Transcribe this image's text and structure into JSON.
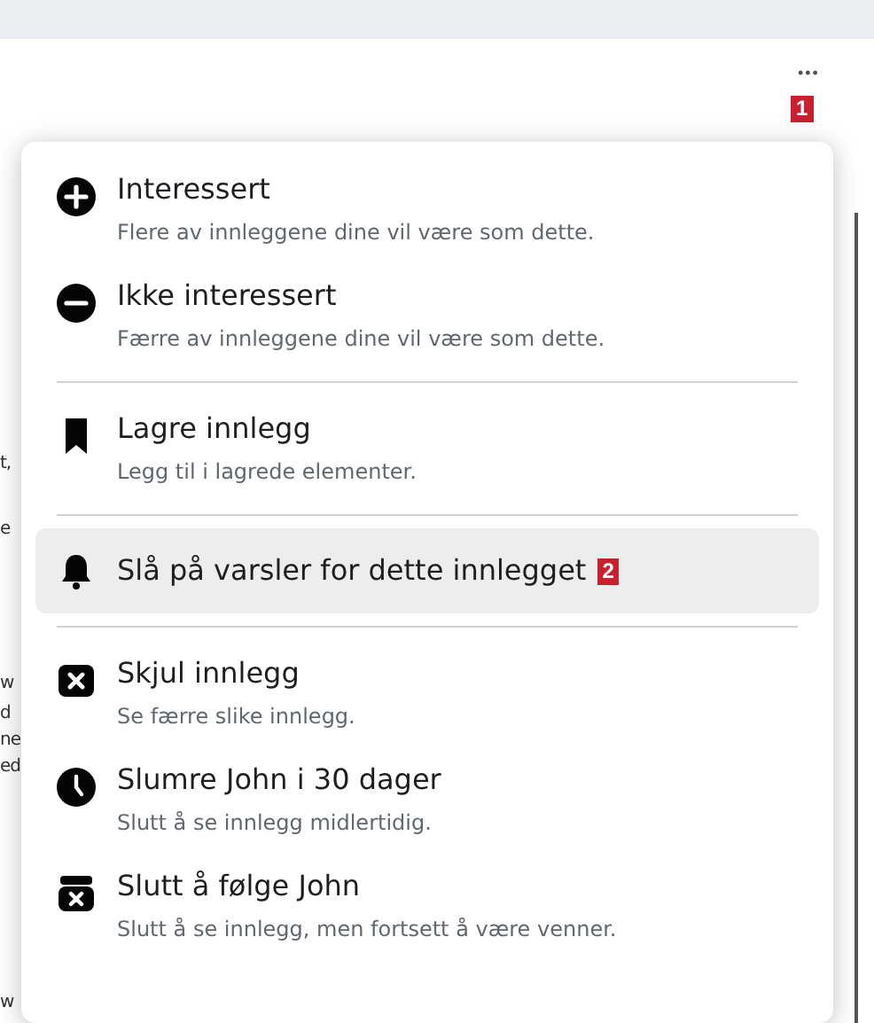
{
  "background_fragments": [
    "t,",
    "e",
    "w",
    "d",
    "ne",
    "ed",
    "w"
  ],
  "more_button": {
    "label": "•••",
    "badge": "1"
  },
  "menu": {
    "sections": [
      {
        "items": [
          {
            "title": "Interessert",
            "subtitle": "Flere av innleggene dine vil være som dette.",
            "highlighted": false
          },
          {
            "title": "Ikke interessert",
            "subtitle": "Færre av innleggene dine vil være som dette.",
            "highlighted": false
          }
        ]
      },
      {
        "items": [
          {
            "title": "Lagre innlegg",
            "subtitle": "Legg til i lagrede elementer.",
            "highlighted": false
          }
        ]
      },
      {
        "items": [
          {
            "title": "Slå på varsler for dette innlegget",
            "badge": "2",
            "highlighted": true
          }
        ]
      },
      {
        "items": [
          {
            "title": "Skjul innlegg",
            "subtitle": "Se færre slike innlegg.",
            "highlighted": false
          },
          {
            "title": "Slumre John i 30 dager",
            "subtitle": "Slutt å se innlegg midlertidig.",
            "highlighted": false
          },
          {
            "title": "Slutt å følge John",
            "subtitle": "Slutt å se innlegg, men fortsett å være venner.",
            "highlighted": false
          }
        ]
      }
    ]
  }
}
